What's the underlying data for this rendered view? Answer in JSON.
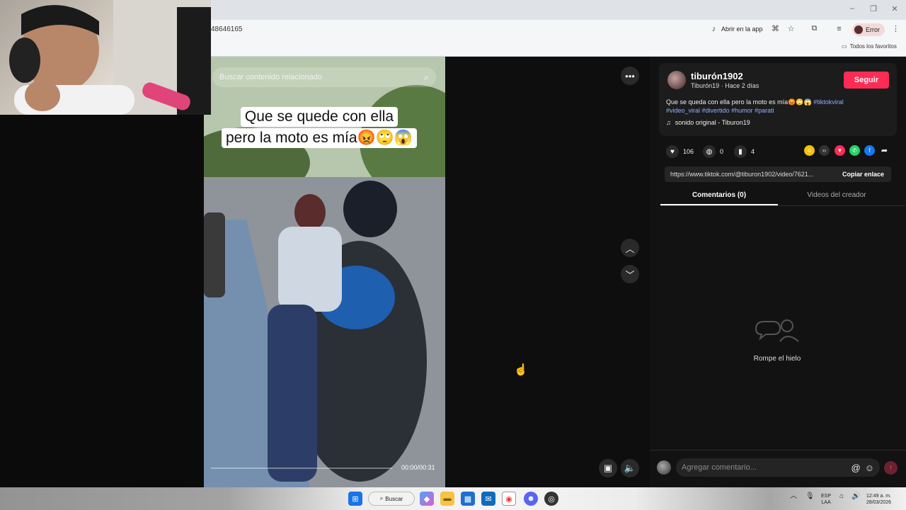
{
  "browser": {
    "url_fragment": "48646165",
    "open_in_app": "Abrir en la app",
    "profile_status": "Error",
    "bookmarks_label": "Todos los favoritos",
    "window_controls": [
      "–",
      "❐",
      "✕"
    ]
  },
  "video": {
    "search_placeholder": "Buscar contenido relacionado",
    "caption_line1": "Que se quede con ella",
    "caption_line2": "pero la moto es mía😡🙄😱",
    "timecode": "00:00/00:31",
    "progress": 0.0
  },
  "post": {
    "username": "tiburón1902",
    "display_name": "Tiburón19",
    "separator": "·",
    "posted_ago": "Hace 2 días",
    "follow_label": "Seguir",
    "description_text": "Que se queda con ella pero la moto es mía😡🙄😱",
    "hashtags": [
      "#tiktokviral",
      "#video_viral",
      "#divertido",
      "#humor",
      "#parati"
    ],
    "sound": "sonido original - Tiburon19",
    "likes": "106",
    "comments": "0",
    "saves": "4",
    "link_url": "https://www.tiktok.com/@tiburon1902/video/7621...",
    "copy_link_label": "Copiar enlace"
  },
  "tabs": [
    {
      "label": "Comentarios (0)",
      "active": true
    },
    {
      "label": "Videos del creador",
      "active": false
    }
  ],
  "comments_empty": "Rompe el hielo",
  "comment_input_placeholder": "Agregar comentario...",
  "taskbar": {
    "search_label": "Buscar",
    "lang_top": "ESP",
    "lang_bottom": "LAA",
    "time": "12:49 a. m.",
    "date": "28/03/2026"
  },
  "colors": {
    "accent": "#fe2c55",
    "hashtag": "#8fb2ff",
    "panel_bg": "#121212"
  }
}
